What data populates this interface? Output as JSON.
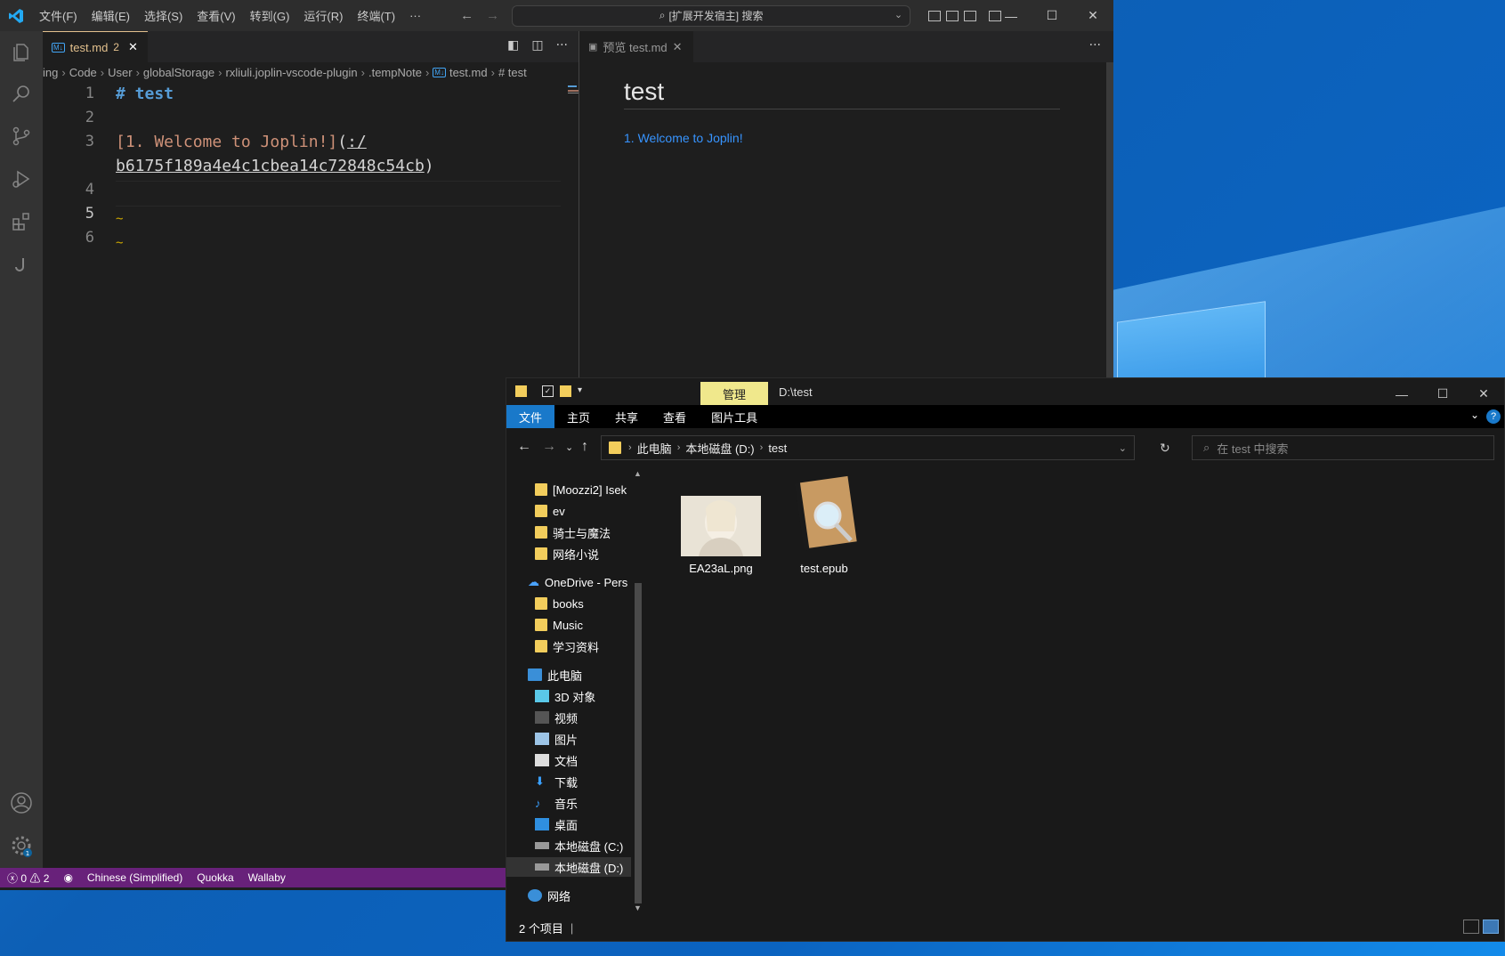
{
  "vscode": {
    "menu": [
      "文件(F)",
      "编辑(E)",
      "选择(S)",
      "查看(V)",
      "转到(G)",
      "运行(R)",
      "终端(T)",
      "···"
    ],
    "search_placeholder": "[扩展开发宿主] 搜索",
    "tab1": {
      "name": "test.md",
      "problems": "2"
    },
    "breadcrumb": [
      "ing",
      "Code",
      "User",
      "globalStorage",
      "rxliuli.joplin-vscode-plugin",
      ".tempNote",
      "test.md",
      "# test"
    ],
    "code": {
      "line_numbers": [
        "1",
        "2",
        "3",
        "",
        "4",
        "5",
        "6"
      ],
      "line1": "# test",
      "line3_link": "[1. Welcome to Joplin!]",
      "line3_paren_open": "(",
      "line3_url1": ":/",
      "line3_url2": "b6175f189a4e4c1cbea14c72848c54cb",
      "line3_paren_close": ")",
      "squiggle": "~"
    },
    "tab2": {
      "name": "预览 test.md"
    },
    "preview": {
      "heading": "test",
      "link": "1. Welcome to Joplin!"
    },
    "status": {
      "errors": "0",
      "warnings": "2",
      "language": "Chinese (Simplified)",
      "ext1": "Quokka",
      "ext2": "Wallaby"
    },
    "accent": "#68217a"
  },
  "explorer": {
    "title": "D:\\test",
    "context_tab": "管理",
    "ribbon": [
      "文件",
      "主页",
      "共享",
      "查看",
      "图片工具"
    ],
    "address": [
      "此电脑",
      "本地磁盘 (D:)",
      "test"
    ],
    "search_placeholder": "在 test 中搜索",
    "sidebar": {
      "folders1": [
        "[Moozzi2] Isek",
        "ev",
        "骑士与魔法",
        "网络小说"
      ],
      "onedrive": "OneDrive - Pers",
      "folders2": [
        "books",
        "Music",
        "学习资料"
      ],
      "thispc": "此电脑",
      "pc_items": [
        "3D 对象",
        "视频",
        "图片",
        "文档",
        "下载",
        "音乐",
        "桌面",
        "本地磁盘 (C:)",
        "本地磁盘 (D:)"
      ],
      "network": "网络"
    },
    "files": [
      {
        "name": "EA23aL.png"
      },
      {
        "name": "test.epub"
      }
    ],
    "status": "2 个项目"
  }
}
